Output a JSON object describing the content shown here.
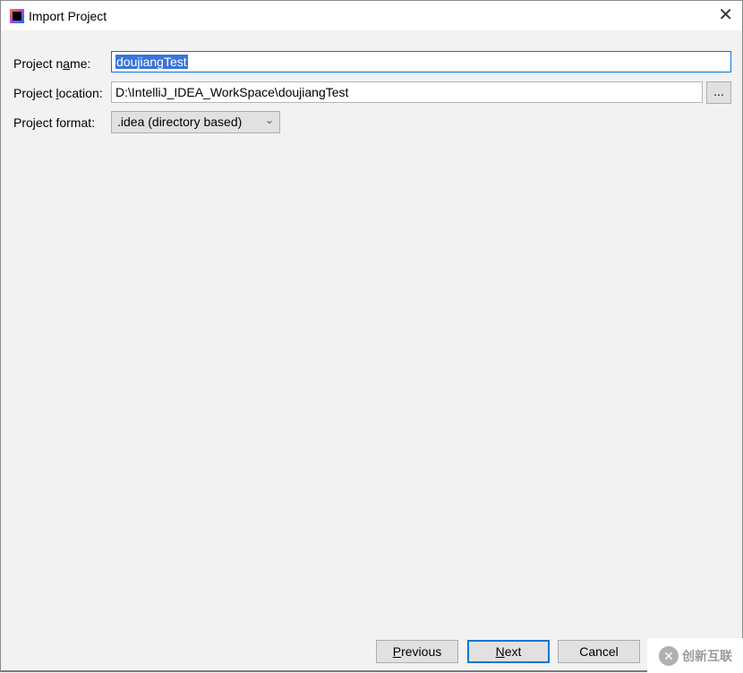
{
  "window": {
    "title": "Import Project",
    "icon": "intellij-idea-icon",
    "close_icon": "close-icon"
  },
  "form": {
    "name_label_pre": "Project n",
    "name_label_u": "a",
    "name_label_post": "me:",
    "name_value": "doujiangTest",
    "location_label_pre": "Project ",
    "location_label_u": "l",
    "location_label_post": "ocation:",
    "location_value": "D:\\IntelliJ_IDEA_WorkSpace\\doujiangTest",
    "browse_label": "...",
    "format_label": "Project format:",
    "format_value": ".idea (directory based)"
  },
  "buttons": {
    "previous_u": "P",
    "previous_rest": "revious",
    "next_u": "N",
    "next_rest": "ext",
    "cancel": "Cancel"
  },
  "watermark": {
    "text": "创新互联",
    "logo": "chuangxin-hulian-logo"
  },
  "colors": {
    "accent": "#0078d7",
    "selection": "#3875d7"
  }
}
